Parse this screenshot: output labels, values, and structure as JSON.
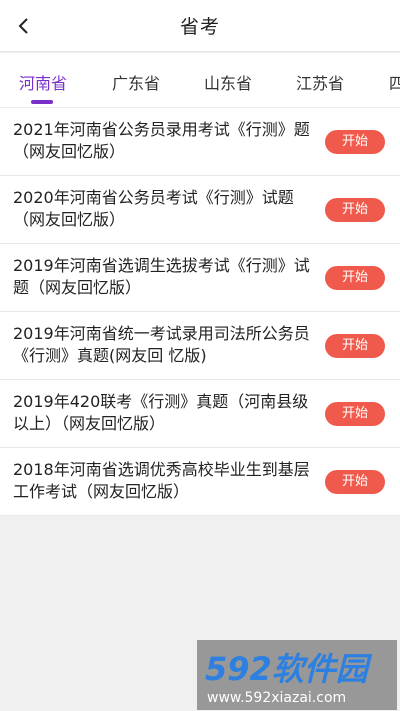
{
  "header": {
    "title": "省考",
    "back_icon": "chevron-left-icon"
  },
  "tabs": [
    {
      "label": "河南省",
      "active": true
    },
    {
      "label": "广东省",
      "active": false
    },
    {
      "label": "山东省",
      "active": false
    },
    {
      "label": "江苏省",
      "active": false
    },
    {
      "label": "四",
      "active": false
    }
  ],
  "list": {
    "items": [
      {
        "title": "2021年河南省公务员录用考试《行测》题（网友回忆版）",
        "button": "开始"
      },
      {
        "title": "2020年河南省公务员考试《行测》试题（网友回忆版）",
        "button": "开始"
      },
      {
        "title": "2019年河南省选调生选拔考试《行测》试题（网友回忆版）",
        "button": "开始"
      },
      {
        "title": "2019年河南省统一考试录用司法所公务员《行测》真题(网友回 忆版)",
        "button": "开始"
      },
      {
        "title": "2019年420联考《行测》真题（河南县级以上）（网友回忆版）",
        "button": "开始"
      },
      {
        "title": "2018年河南省选调优秀高校毕业生到基层工作考试（网友回忆版）",
        "button": "开始"
      }
    ]
  },
  "watermark": {
    "brand": "592软件园",
    "url": "www.592xiazai.com"
  },
  "colors": {
    "accent": "#7b2fc9",
    "button": "#f05a4c",
    "background": "#f0f0f0"
  }
}
